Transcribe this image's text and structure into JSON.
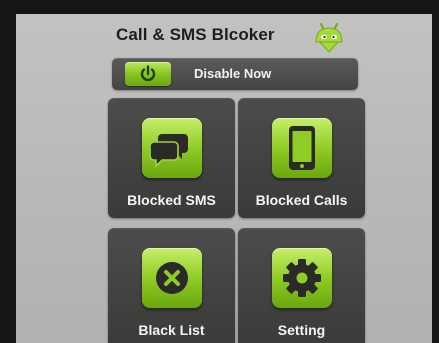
{
  "app": {
    "title": "Call & SMS Blcoker",
    "logo_icon": "android-head-icon",
    "accent_color": "#8fcc25"
  },
  "disable": {
    "label": "Disable Now",
    "icon": "power-icon"
  },
  "tiles": [
    {
      "label": "Blocked SMS",
      "icon": "chat-bubbles-icon"
    },
    {
      "label": "Blocked Calls",
      "icon": "phone-device-icon"
    },
    {
      "label": "Black List",
      "icon": "x-circle-icon"
    },
    {
      "label": "Setting",
      "icon": "gear-icon"
    }
  ]
}
